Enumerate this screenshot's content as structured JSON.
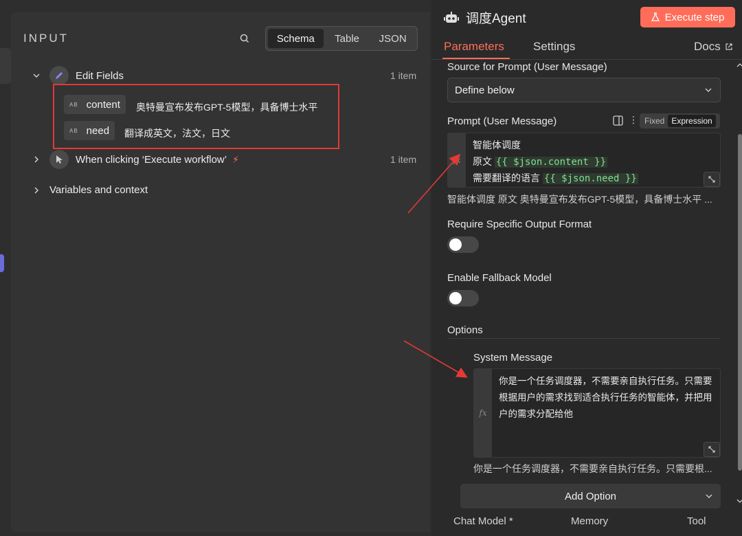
{
  "input_panel": {
    "title": "INPUT",
    "view_tabs": [
      "Schema",
      "Table",
      "JSON"
    ],
    "active_view": "Schema",
    "tree": [
      {
        "label": "Edit Fields",
        "count": "1 item",
        "icon": "pencil-icon",
        "expanded": true,
        "fields": [
          {
            "type": "AB",
            "name": "content",
            "value": "奥特曼宣布发布GPT-5模型，具备博士水平"
          },
          {
            "type": "AB",
            "name": "need",
            "value": "翻译成英文，法文，日文"
          }
        ]
      },
      {
        "label": "When clicking ‘Execute workflow’",
        "count": "1 item",
        "icon": "cursor-icon",
        "badge_icon": "bolt-icon"
      },
      {
        "label": "Variables and context"
      }
    ]
  },
  "node_panel": {
    "title": "调度Agent",
    "execute_label": "Execute step",
    "tabs": [
      "Parameters",
      "Settings"
    ],
    "active_tab": "Parameters",
    "docs_label": "Docs",
    "source_label": "Source for Prompt (User Message)",
    "source_value": "Define below",
    "prompt_label": "Prompt (User Message)",
    "mode_options": [
      "Fixed",
      "Expression"
    ],
    "active_mode": "Expression",
    "prompt_lines": [
      {
        "text": "智能体调度",
        "var": ""
      },
      {
        "text": "原文 ",
        "var": "{{ $json.content }}"
      },
      {
        "text": "需要翻译的语言 ",
        "var": "{{ $json.need }}"
      }
    ],
    "prompt_preview": "智能体调度 原文 奥特曼宣布发布GPT-5模型，具备博士水平 ...",
    "require_format_label": "Require Specific Output Format",
    "fallback_label": "Enable Fallback Model",
    "require_format_enabled": false,
    "fallback_enabled": false,
    "options_label": "Options",
    "system_message_label": "System Message",
    "system_message": "你是一个任务调度器，不需要亲自执行任务。只需要根据用户的需求找到适合执行任务的智能体，并把用户的需求分配给他",
    "system_preview": "你是一个任务调度器，不需要亲自执行任务。只需要根...",
    "add_option_label": "Add Option",
    "bottom_labels": [
      "Chat Model *",
      "Memory",
      "Tool"
    ]
  },
  "colors": {
    "accent": "#ff6d5a",
    "annotation": "#e53935",
    "expression_var": "#7ee08f"
  }
}
